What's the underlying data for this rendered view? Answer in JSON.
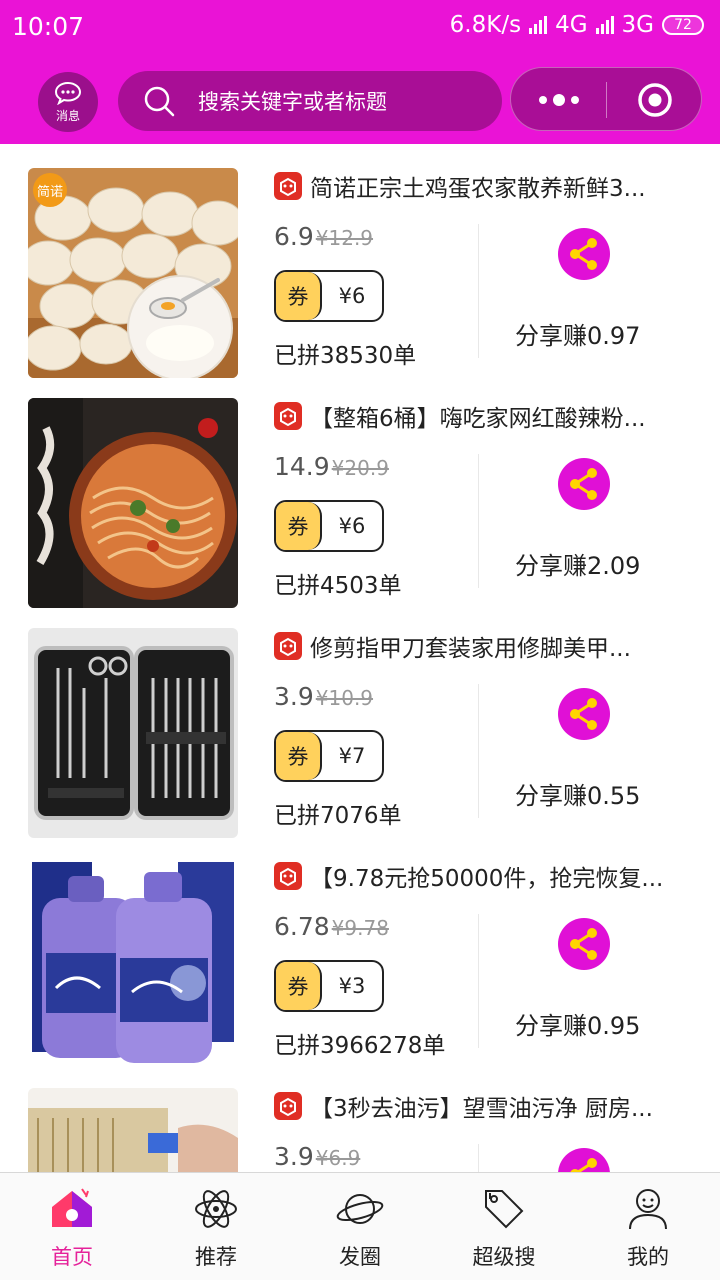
{
  "status_bar": {
    "time": "10:07",
    "network_speed": "6.8K/s",
    "net1": "4G",
    "net2": "3G",
    "battery": "72"
  },
  "header": {
    "message_label": "消息",
    "search_placeholder": "搜索关键字或者标题"
  },
  "products": [
    {
      "title": "简诺正宗土鸡蛋农家散养新鲜3...",
      "price": "6.9",
      "original_price": "¥12.9",
      "coupon_label": "券",
      "coupon_value": "¥6",
      "sold": "已拼38530单",
      "share_label": "分享赚0.97",
      "thumb_badge": "简诺"
    },
    {
      "title": "【整箱6桶】嗨吃家网红酸辣粉...",
      "price": "14.9",
      "original_price": "¥20.9",
      "coupon_label": "券",
      "coupon_value": "¥6",
      "sold": "已拼4503单",
      "share_label": "分享赚2.09"
    },
    {
      "title": "修剪指甲刀套装家用修脚美甲...",
      "price": "3.9",
      "original_price": "¥10.9",
      "coupon_label": "券",
      "coupon_value": "¥7",
      "sold": "已拼7076单",
      "share_label": "分享赚0.55"
    },
    {
      "title": "【9.78元抢50000件，抢完恢复...",
      "price": "6.78",
      "original_price": "¥9.78",
      "coupon_label": "券",
      "coupon_value": "¥3",
      "sold": "已拼3966278单",
      "share_label": "分享赚0.95"
    },
    {
      "title": "【3秒去油污】望雪油污净 厨房...",
      "price": "3.9",
      "original_price": "¥6.9"
    }
  ],
  "tabs": [
    {
      "label": "首页",
      "icon": "home-icon",
      "active": true
    },
    {
      "label": "推荐",
      "icon": "atom-icon"
    },
    {
      "label": "发圈",
      "icon": "planet-icon"
    },
    {
      "label": "超级搜",
      "icon": "tag-icon"
    },
    {
      "label": "我的",
      "icon": "user-icon"
    }
  ],
  "colors": {
    "brand": "#ea13d6",
    "share_circle": "#e010d6",
    "coupon_yellow": "#ffd15c",
    "active_tab": "#e5219a"
  }
}
